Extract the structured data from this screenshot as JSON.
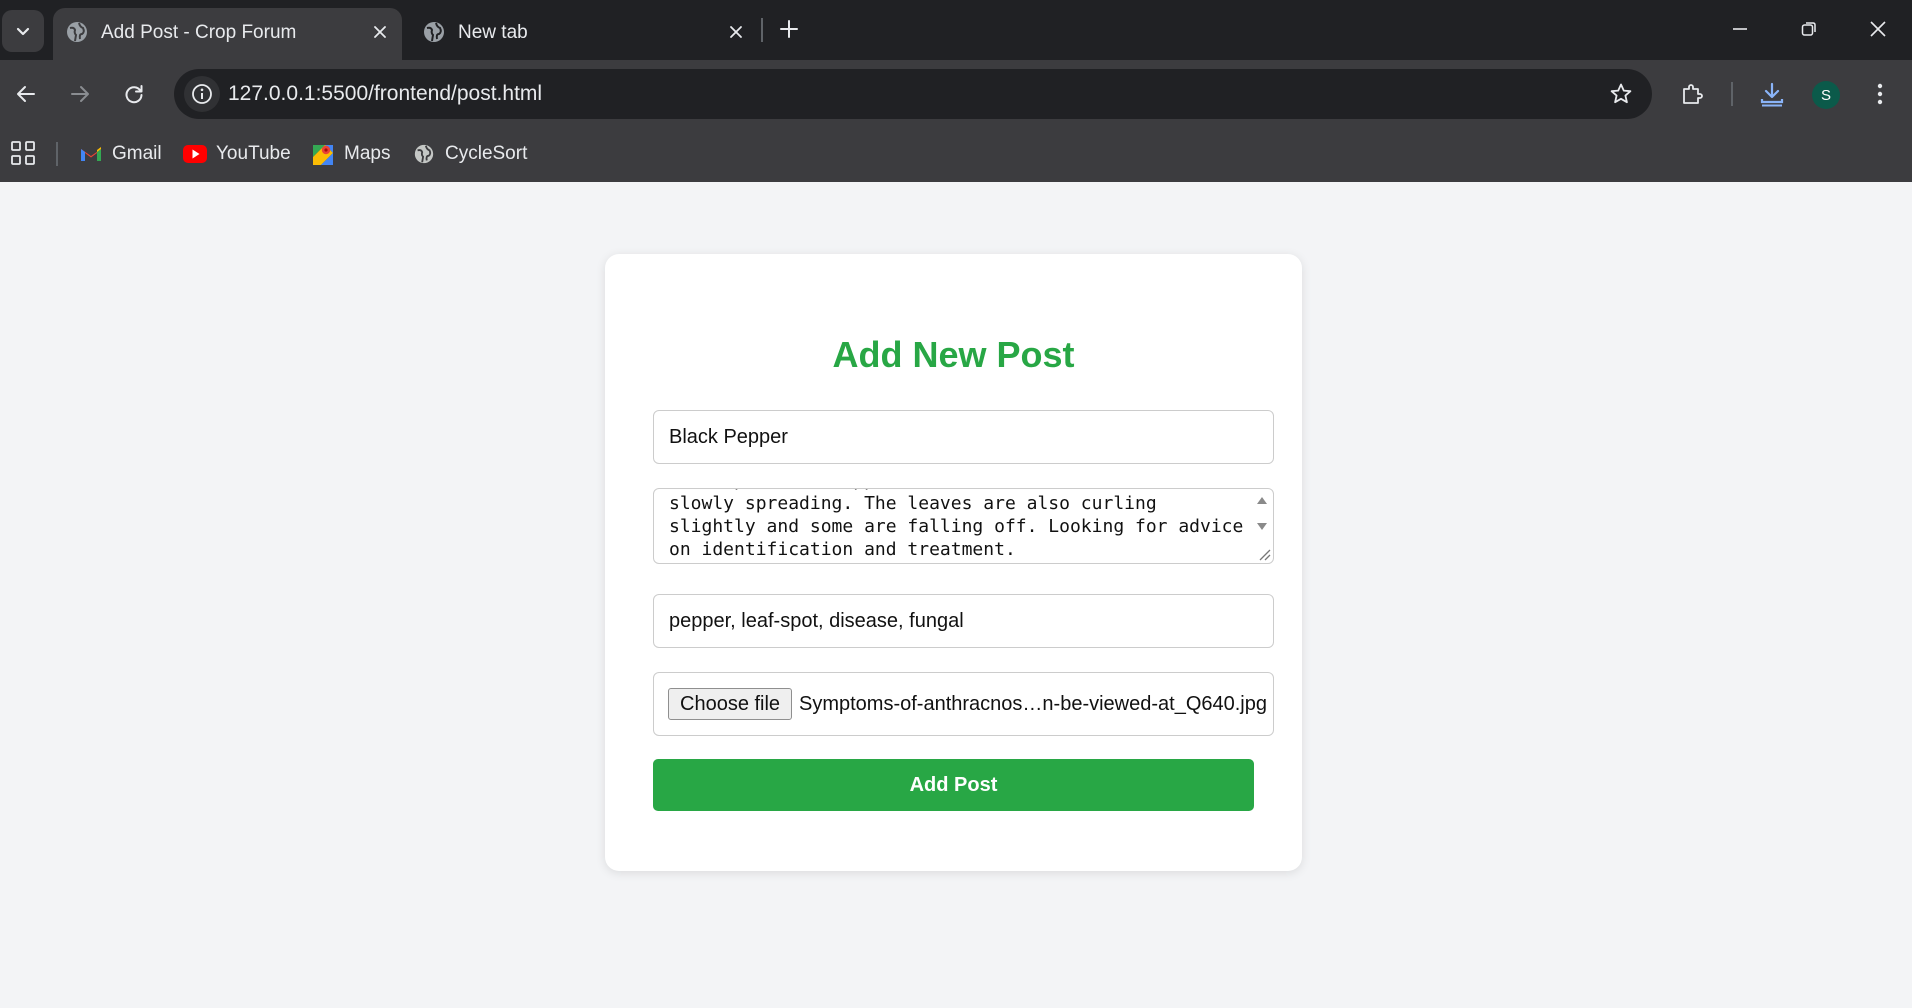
{
  "browser": {
    "tabs": [
      {
        "title": "Add Post - Crop Forum",
        "active": true,
        "icon": "globe-icon"
      },
      {
        "title": "New tab",
        "active": false,
        "icon": "globe-icon"
      }
    ],
    "url": "127.0.0.1:5500/frontend/post.html",
    "profile_initial": "S",
    "bookmarks": [
      {
        "label": "Gmail",
        "icon": "gmail-icon"
      },
      {
        "label": "YouTube",
        "icon": "youtube-icon"
      },
      {
        "label": "Maps",
        "icon": "maps-icon"
      },
      {
        "label": "CycleSort",
        "icon": "globe-icon"
      }
    ]
  },
  "form": {
    "heading": "Add New Post",
    "title_value": "Black Pepper",
    "description_value": "Dark spots have appeared on the leaves and seem to be slowly spreading. The leaves are also curling slightly and some are falling off. Looking for advice on identification and treatment.",
    "tags_value": "pepper, leaf-spot, disease, fungal",
    "file_button_label": "Choose file",
    "file_name": "Symptoms-of-anthracnos…n-be-viewed-at_Q640.jpg",
    "submit_label": "Add Post"
  },
  "colors": {
    "accent": "#28a745",
    "page_bg": "#f3f4f6",
    "chrome_dark": "#202124",
    "chrome_toolbar": "#3c3c3f"
  }
}
